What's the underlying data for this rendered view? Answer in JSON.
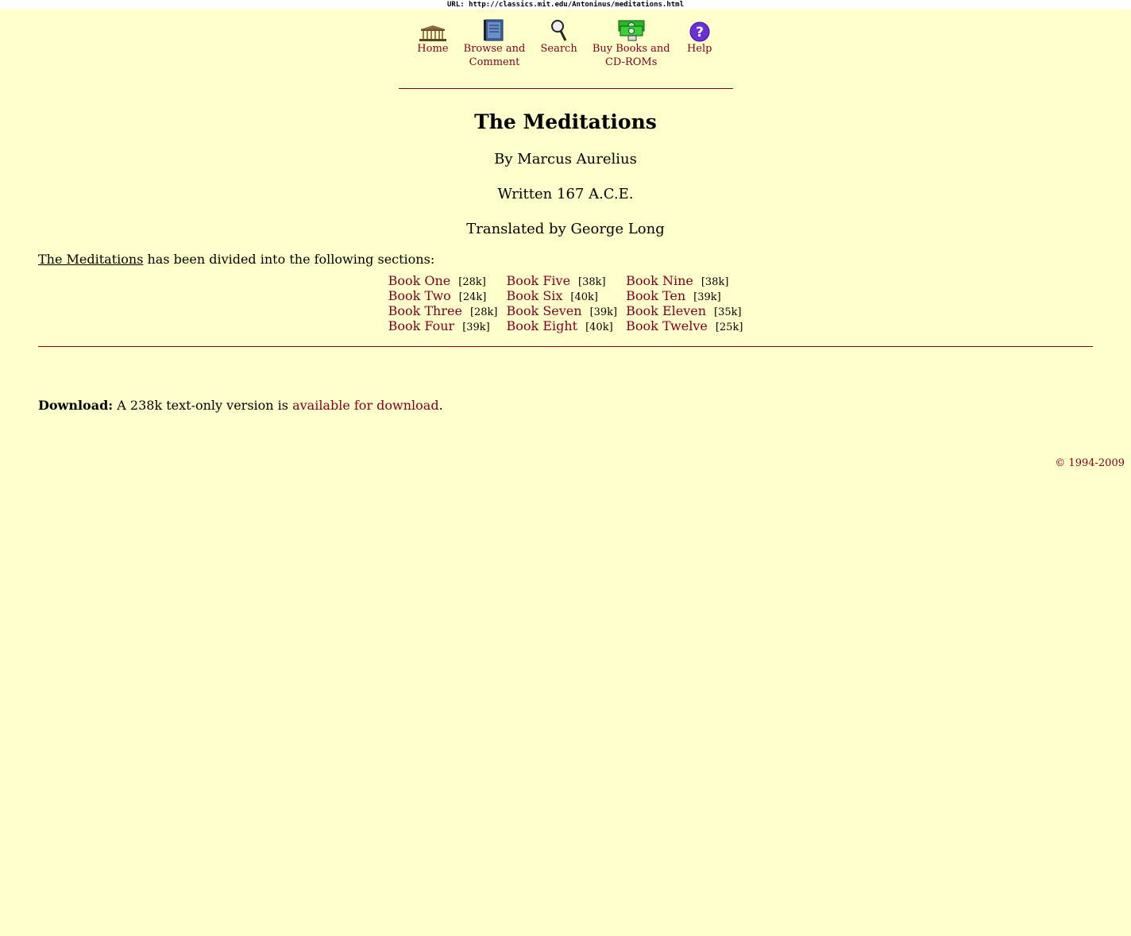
{
  "url_bar": "URL: http://classics.mit.edu/Antoninus/meditations.html",
  "nav": [
    {
      "label": "Home",
      "icon": "temple-icon"
    },
    {
      "label": "Browse and Comment",
      "icon": "book-icon"
    },
    {
      "label": "Search",
      "icon": "magnifier-icon"
    },
    {
      "label": "Buy Books and CD-ROMs",
      "icon": "money-icon"
    },
    {
      "label": "Help",
      "icon": "question-icon"
    }
  ],
  "title": "The Meditations",
  "author": "By Marcus Aurelius",
  "written": "Written 167 A.C.E.",
  "translator": "Translated by George Long",
  "intro": {
    "work_title": "The Meditations",
    "text": " has been divided into the following sections:"
  },
  "books": [
    [
      {
        "label": "Book One",
        "size": "[28k]"
      },
      {
        "label": "Book Two",
        "size": "[24k]"
      },
      {
        "label": "Book Three",
        "size": "[28k]"
      },
      {
        "label": "Book Four",
        "size": "[39k]"
      }
    ],
    [
      {
        "label": "Book Five",
        "size": "[38k]"
      },
      {
        "label": "Book Six",
        "size": "[40k]"
      },
      {
        "label": "Book Seven",
        "size": "[39k]"
      },
      {
        "label": "Book Eight",
        "size": "[40k]"
      }
    ],
    [
      {
        "label": "Book Nine",
        "size": "[38k]"
      },
      {
        "label": "Book Ten",
        "size": "[39k]"
      },
      {
        "label": "Book Eleven",
        "size": "[35k]"
      },
      {
        "label": "Book Twelve",
        "size": "[25k]"
      }
    ]
  ],
  "download": {
    "label": "Download:",
    "text": " A 238k text-only version is ",
    "link": "available for download",
    "end": "."
  },
  "copyright": "© 1994-2009",
  "colors": {
    "background": "#ffffcc",
    "link": "#800020"
  }
}
